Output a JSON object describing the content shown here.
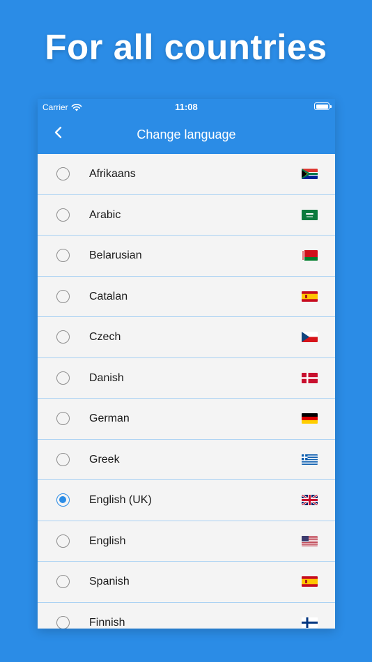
{
  "headline": "For all countries",
  "statusbar": {
    "carrier": "Carrier",
    "time": "11:08"
  },
  "navbar": {
    "title": "Change language"
  },
  "languages": [
    {
      "label": "Afrikaans",
      "flag": "south-africa-flag-icon",
      "selected": false
    },
    {
      "label": "Arabic",
      "flag": "saudi-arabia-flag-icon",
      "selected": false
    },
    {
      "label": "Belarusian",
      "flag": "belarus-flag-icon",
      "selected": false
    },
    {
      "label": "Catalan",
      "flag": "spain-flag-icon",
      "selected": false
    },
    {
      "label": "Czech",
      "flag": "czech-flag-icon",
      "selected": false
    },
    {
      "label": "Danish",
      "flag": "denmark-flag-icon",
      "selected": false
    },
    {
      "label": "German",
      "flag": "germany-flag-icon",
      "selected": false
    },
    {
      "label": "Greek",
      "flag": "greece-flag-icon",
      "selected": false
    },
    {
      "label": "English (UK)",
      "flag": "uk-flag-icon",
      "selected": true
    },
    {
      "label": "English",
      "flag": "usa-flag-icon",
      "selected": false
    },
    {
      "label": "Spanish",
      "flag": "spain-flag-icon",
      "selected": false
    },
    {
      "label": "Finnish",
      "flag": "finland-flag-icon",
      "selected": false
    }
  ],
  "colors": {
    "background": "#2b8ce6",
    "list_background": "#f4f4f4",
    "divider": "#a9d1f3",
    "accent": "#2b8ce6"
  }
}
